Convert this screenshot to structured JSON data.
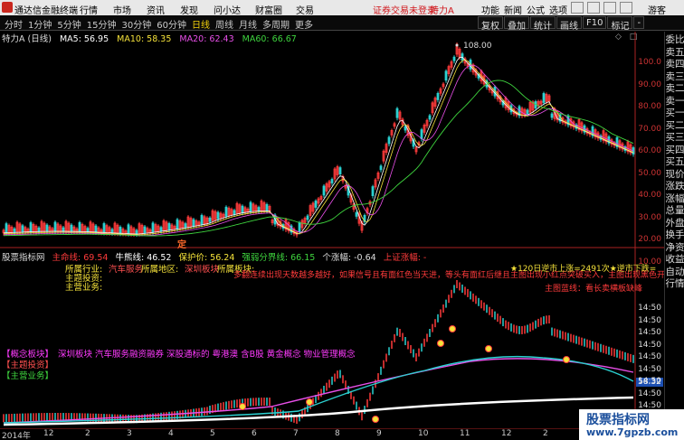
{
  "titlebar": {
    "app_title": "通达信金融终端",
    "menu": [
      "行情",
      "市场",
      "资讯",
      "发现",
      "问小达",
      "财富圈",
      "交易"
    ],
    "notice": "证券交易未登录",
    "stock_name": "特力A",
    "right_menu": [
      "功能",
      "新闻",
      "公式",
      "选项"
    ],
    "guest": "游客"
  },
  "toolbar": {
    "periods": [
      "分时",
      "1分钟",
      "5分钟",
      "15分钟",
      "30分钟",
      "60分钟",
      "日线",
      "周线",
      "月线",
      "多周期",
      "更多"
    ],
    "active_period": "日线",
    "tools": [
      "复权",
      "叠加",
      "统计",
      "画线",
      "F10",
      "标记",
      "-"
    ]
  },
  "chart": {
    "title": "特力A (日线)",
    "ma5": "MA5: 56.95",
    "ma10": "MA10: 58.35",
    "ma20": "MA20: 62.43",
    "ma60": "MA60: 66.67",
    "high_label": "108.00",
    "low_marker": "定",
    "colors": {
      "up": "#ff3b3b",
      "down": "#2bd1d1",
      "ma5": "#ffffff",
      "ma10": "#f5e23a",
      "ma20": "#e84fe8",
      "ma60": "#3ed43e"
    }
  },
  "price_axis": [
    "100.0",
    "90.00",
    "80.00",
    "70.00",
    "60.00",
    "50.00",
    "40.00",
    "30.00",
    "20.00",
    "10.00"
  ],
  "sidebar": [
    "委比",
    "卖五",
    "卖四",
    "卖三",
    "卖二",
    "卖一",
    "买一",
    "买二",
    "买三",
    "买四",
    "买五",
    "现价",
    "涨跌",
    "涨幅",
    "总量",
    "外盘",
    "换手",
    "净资",
    "收益",
    "自动",
    "行情"
  ],
  "indicator": {
    "name": "股票指标网",
    "life_line": "主命线: 69.54",
    "bull_bear": "牛熊线: 46.52",
    "protect": "保护价: 56.24",
    "strong_weak": "强弱分界线: 66.15",
    "rise": "个涨幅: -0.64",
    "trend": "上证涨幅: -",
    "industry_label": "所属行业:",
    "industry": "汽车服务",
    "region_label": "所属地区:",
    "region": "深圳板块",
    "sector_label": "所属板块:",
    "theme_label": "主题投资:",
    "biz_label": "主营业务:",
    "concept_label": "【概念板块】",
    "concepts": "深圳板块 汽车服务融资融券 深股通标的 粤港澳 含B股 黄金概念 物业管理概念",
    "theme2": "【主题投资】",
    "biz2": "【主营业务】",
    "warn": "多翻连续出现天数越多越好，如果信号且有面红色当天进，等头有面红后继且主图出现小红点突破买入，主图出现黑色开始提醒信号",
    "count_up": "★120日逆市上涨=2491次★逆市下跌=",
    "stat_line": "主图蓝线：看长卖横板缺峰",
    "val_tag": "58.32",
    "axis": [
      "14:50",
      "14:50",
      "14:50",
      "14:50",
      "14:50",
      "14:50",
      "14:50",
      "14:50",
      "14:50"
    ]
  },
  "dates": [
    "2014年",
    "12",
    "2",
    "3",
    "4",
    "5",
    "6",
    "7",
    "8",
    "9",
    "10",
    "11",
    "12",
    "2",
    "3",
    "4"
  ],
  "watermark": {
    "line1": "股票指标网",
    "line2": "www.7gpzb.com"
  }
}
